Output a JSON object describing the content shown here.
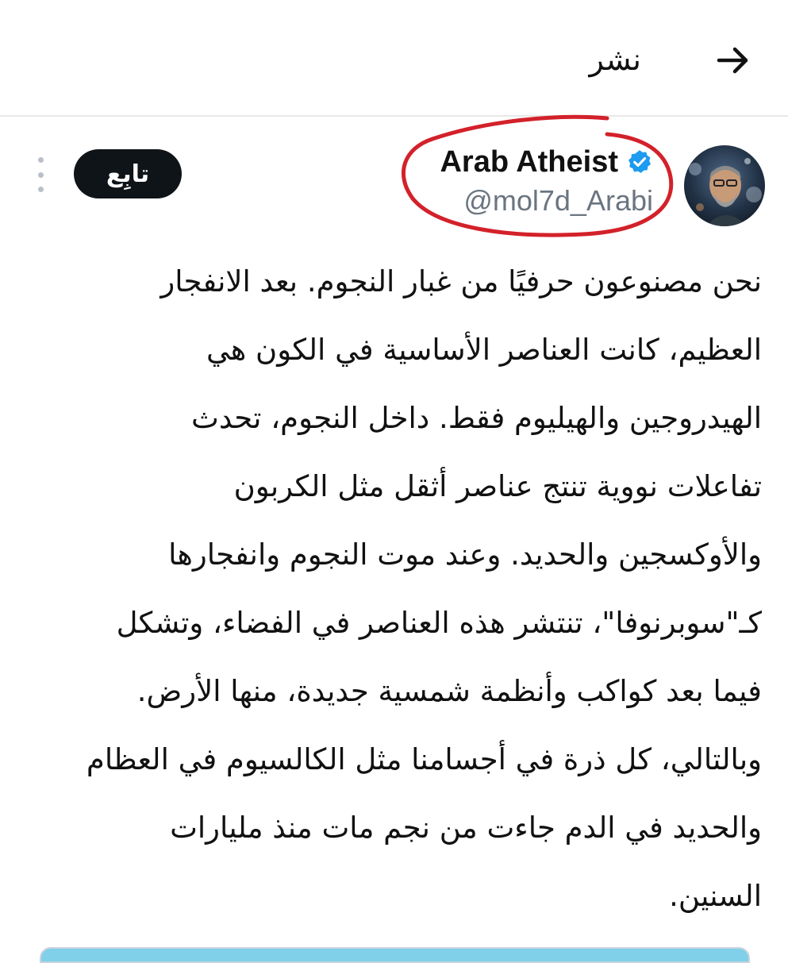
{
  "header": {
    "title": "نشر",
    "back_icon": "arrow-right-icon"
  },
  "author": {
    "display_name": "Arab Atheist",
    "handle": "@mol7d_Arabi",
    "verified": true,
    "verified_color": "#1d9bf0",
    "annotation_color": "#d3212a"
  },
  "actions": {
    "follow_label": "تابِع",
    "more_icon": "more-vertical-icon"
  },
  "tweet": {
    "lines": [
      "نحن مصنوعون حرفيًا من غبار النجوم. بعد الانفجار",
      "العظيم، كانت العناصر الأساسية في الكون هي",
      "الهيدروجين والهيليوم فقط. داخل النجوم، تحدث",
      "تفاعلات نووية تنتج عناصر أثقل مثل الكربون",
      "والأوكسجين والحديد. وعند موت النجوم وانفجارها",
      "كـ\"سوبرنوفا\"، تنتشر هذه العناصر في الفضاء، وتشكل",
      "فيما بعد كواكب وأنظمة شمسية جديدة، منها الأرض.",
      "وبالتالي، كل ذرة في أجسامنا مثل  الكالسيوم في العظام",
      "والحديد في الدم جاءت من نجم مات منذ مليارات",
      "السنين."
    ]
  }
}
